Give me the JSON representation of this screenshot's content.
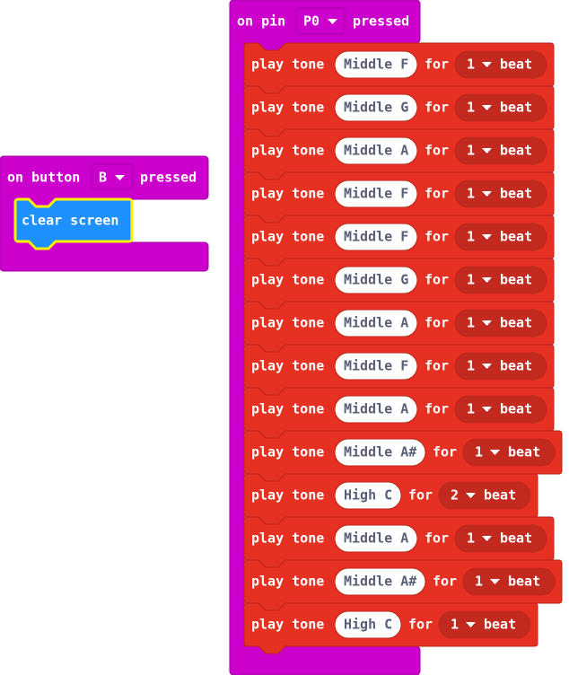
{
  "colors": {
    "events": "#cc00cc",
    "events_dark": "#a300a3",
    "music": "#e63022",
    "music_dark": "#b8261b",
    "music_pill": "#c32a1f",
    "basic": "#1e90ff",
    "basic_dark": "#1873cc",
    "selected_outline": "#fff200",
    "note_pill_text": "#575e75"
  },
  "button_event": {
    "label_prefix": "on button",
    "button_value": "B",
    "label_suffix": "pressed",
    "dropdown_icon": "triangle-down-icon",
    "child": {
      "label": "clear screen",
      "selected": true
    }
  },
  "pin_event": {
    "label_prefix": "on pin",
    "pin_value": "P0",
    "label_suffix": "pressed",
    "dropdown_icon": "triangle-down-icon",
    "play_label": "play tone",
    "for_label": "for",
    "beat_label": "beat",
    "tones": [
      {
        "note": "Middle F",
        "beats": "1"
      },
      {
        "note": "Middle G",
        "beats": "1"
      },
      {
        "note": "Middle A",
        "beats": "1"
      },
      {
        "note": "Middle F",
        "beats": "1"
      },
      {
        "note": "Middle F",
        "beats": "1"
      },
      {
        "note": "Middle G",
        "beats": "1"
      },
      {
        "note": "Middle A",
        "beats": "1"
      },
      {
        "note": "Middle F",
        "beats": "1"
      },
      {
        "note": "Middle A",
        "beats": "1"
      },
      {
        "note": "Middle A#",
        "beats": "1"
      },
      {
        "note": "High C",
        "beats": "2"
      },
      {
        "note": "Middle A",
        "beats": "1"
      },
      {
        "note": "Middle A#",
        "beats": "1"
      },
      {
        "note": "High C",
        "beats": "1"
      }
    ]
  }
}
